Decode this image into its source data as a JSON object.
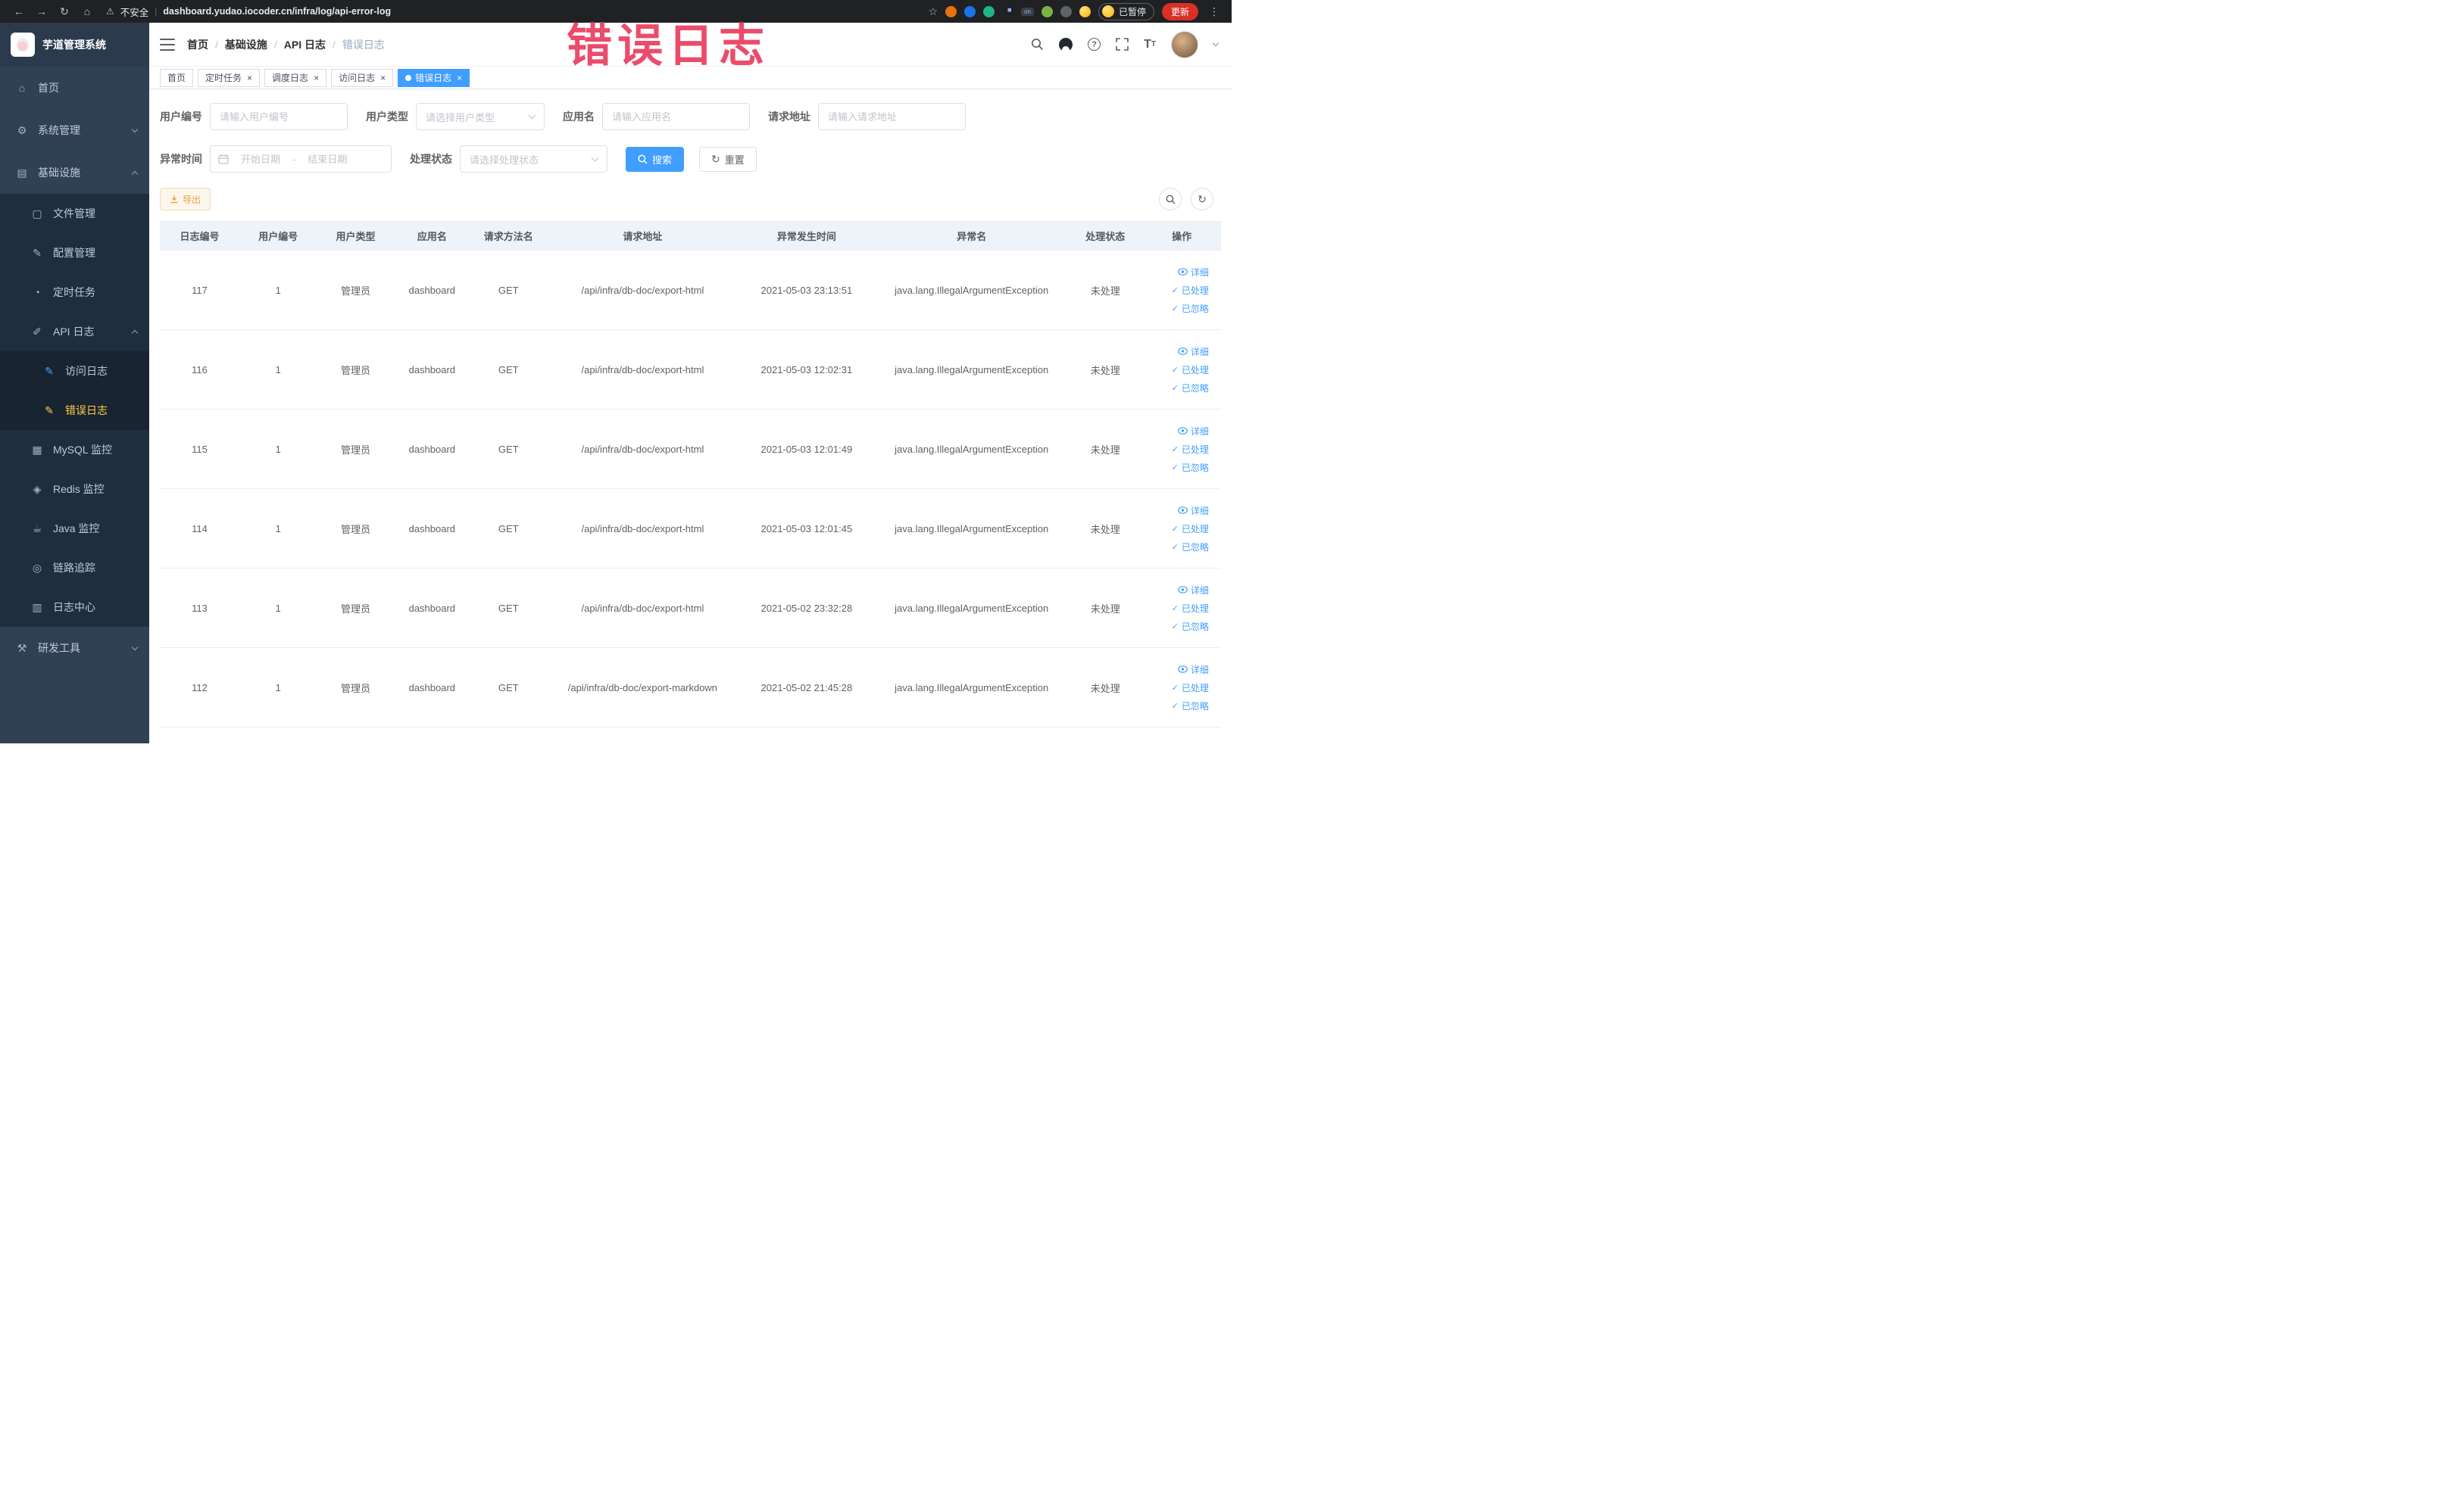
{
  "watermark": "错误日志",
  "browser": {
    "security_label": "不安全",
    "url": "dashboard.yudao.iocoder.cn/infra/log/api-error-log",
    "ext_badge": "on",
    "paused_label": "已暂停",
    "update_label": "更新"
  },
  "sidebar": {
    "logo_title": "芋道管理系统",
    "home": "首页",
    "system_mgmt": "系统管理",
    "infrastructure": "基础设施",
    "file_mgmt": "文件管理",
    "config_mgmt": "配置管理",
    "scheduled_jobs": "定时任务",
    "api_logs": "API 日志",
    "access_log": "访问日志",
    "error_log": "错误日志",
    "mysql_monitor": "MySQL 监控",
    "redis_monitor": "Redis 监控",
    "java_monitor": "Java 监控",
    "tracing": "链路追踪",
    "log_center": "日志中心",
    "dev_tools": "研发工具"
  },
  "breadcrumb": [
    "首页",
    "基础设施",
    "API 日志",
    "错误日志"
  ],
  "tabs": {
    "home": "首页",
    "job": "定时任务",
    "job_log": "调度日志",
    "access_log": "访问日志",
    "error_log": "错误日志"
  },
  "filters": {
    "user_id_label": "用户编号",
    "user_id_placeholder": "请输入用户编号",
    "user_type_label": "用户类型",
    "user_type_placeholder": "请选择用户类型",
    "app_name_label": "应用名",
    "app_name_placeholder": "请输入应用名",
    "request_url_label": "请求地址",
    "request_url_placeholder": "请输入请求地址",
    "exception_time_label": "异常时间",
    "start_date_placeholder": "开始日期",
    "date_separator": "-",
    "end_date_placeholder": "结束日期",
    "process_status_label": "处理状态",
    "process_status_placeholder": "请选择处理状态",
    "search_label": "搜索",
    "reset_label": "重置"
  },
  "toolbar": {
    "export_label": "导出"
  },
  "table": {
    "columns": [
      "日志编号",
      "用户编号",
      "用户类型",
      "应用名",
      "请求方法名",
      "请求地址",
      "异常发生时间",
      "异常名",
      "处理状态",
      "操作"
    ],
    "actions": {
      "detail": "详细",
      "processed": "已处理",
      "ignored": "已忽略"
    },
    "rows": [
      {
        "log_id": "117",
        "user_id": "1",
        "user_type": "管理员",
        "app_name": "dashboard",
        "method": "GET",
        "url": "/api/infra/db-doc/export-html",
        "time": "2021-05-03 23:13:51",
        "exception": "java.lang.IllegalArgumentException",
        "status": "未处理"
      },
      {
        "log_id": "116",
        "user_id": "1",
        "user_type": "管理员",
        "app_name": "dashboard",
        "method": "GET",
        "url": "/api/infra/db-doc/export-html",
        "time": "2021-05-03 12:02:31",
        "exception": "java.lang.IllegalArgumentException",
        "status": "未处理"
      },
      {
        "log_id": "115",
        "user_id": "1",
        "user_type": "管理员",
        "app_name": "dashboard",
        "method": "GET",
        "url": "/api/infra/db-doc/export-html",
        "time": "2021-05-03 12:01:49",
        "exception": "java.lang.IllegalArgumentException",
        "status": "未处理"
      },
      {
        "log_id": "114",
        "user_id": "1",
        "user_type": "管理员",
        "app_name": "dashboard",
        "method": "GET",
        "url": "/api/infra/db-doc/export-html",
        "time": "2021-05-03 12:01:45",
        "exception": "java.lang.IllegalArgumentException",
        "status": "未处理"
      },
      {
        "log_id": "113",
        "user_id": "1",
        "user_type": "管理员",
        "app_name": "dashboard",
        "method": "GET",
        "url": "/api/infra/db-doc/export-html",
        "time": "2021-05-02 23:32:28",
        "exception": "java.lang.IllegalArgumentException",
        "status": "未处理"
      },
      {
        "log_id": "112",
        "user_id": "1",
        "user_type": "管理员",
        "app_name": "dashboard",
        "method": "GET",
        "url": "/api/infra/db-doc/export-markdown",
        "time": "2021-05-02 21:45:28",
        "exception": "java.lang.IllegalArgumentException",
        "status": "未处理"
      }
    ]
  }
}
